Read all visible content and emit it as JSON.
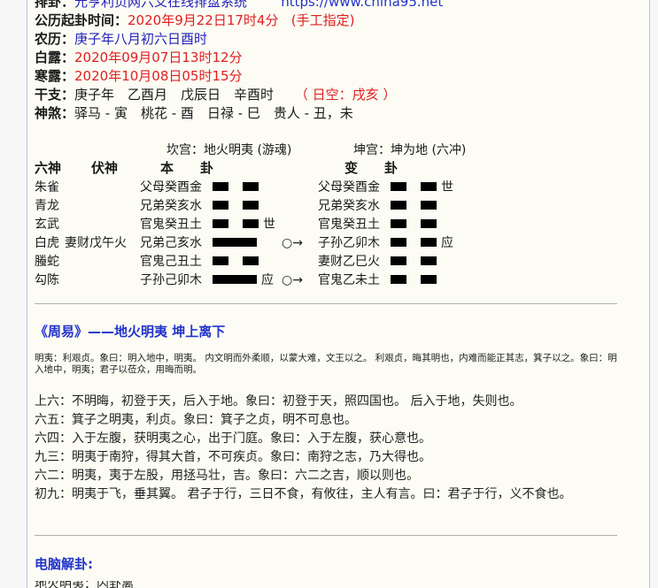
{
  "header": {
    "label_paigua": "排卦：",
    "site_desc": "元亨利贞网六爻在线排盘系统",
    "site_url": "https://www.china95.net",
    "label_time": "公历起卦时间：",
    "time_value": "2020年9月22日17时4分",
    "time_mode": "(手工指定)",
    "label_nongli": "农历：",
    "nongli_value": "庚子年八月初六日酉时",
    "label_bailu": "白露：",
    "bailu_value": "2020年09月07日13时12分",
    "label_hanlu": "寒露：",
    "hanlu_value": "2020年10月08日05时15分",
    "label_ganzhi": "干支：",
    "ganzhi_value": "庚子年　乙酉月　戊辰日　辛酉时",
    "kongwang": "（ 日空：戌亥 ）",
    "label_shensha": "神煞：",
    "shensha_value": "驿马 - 寅　桃花 - 酉　日禄 - 巳　贵人 - 丑，未"
  },
  "hexagram": {
    "main_title": "坎宫：地火明夷 (游魂)",
    "changed_title": "坤宫：坤为地 (六冲)",
    "headers": {
      "liushen": "六神",
      "fushen": "伏神",
      "ben": "本　　卦",
      "bian": "变　　卦"
    },
    "rows": [
      {
        "liushen": "朱雀",
        "fushen": "",
        "ben": "父母癸酉金",
        "ben_line": "yin",
        "ben_mark": "",
        "moving": "",
        "bian": "父母癸酉金",
        "bian_line": "yin",
        "bian_mark": "世"
      },
      {
        "liushen": "青龙",
        "fushen": "",
        "ben": "兄弟癸亥水",
        "ben_line": "yin",
        "ben_mark": "",
        "moving": "",
        "bian": "兄弟癸亥水",
        "bian_line": "yin",
        "bian_mark": ""
      },
      {
        "liushen": "玄武",
        "fushen": "",
        "ben": "官鬼癸丑土",
        "ben_line": "yin",
        "ben_mark": "世",
        "moving": "",
        "bian": "官鬼癸丑土",
        "bian_line": "yin",
        "bian_mark": ""
      },
      {
        "liushen": "白虎",
        "fushen": "妻财戊午火",
        "ben": "兄弟己亥水",
        "ben_line": "yang",
        "ben_mark": "",
        "moving": "○→",
        "bian": "子孙乙卯木",
        "bian_line": "yin",
        "bian_mark": "应"
      },
      {
        "liushen": "螣蛇",
        "fushen": "",
        "ben": "官鬼己丑土",
        "ben_line": "yin",
        "ben_mark": "",
        "moving": "",
        "bian": "妻财乙巳火",
        "bian_line": "yin",
        "bian_mark": ""
      },
      {
        "liushen": "勾陈",
        "fushen": "",
        "ben": "子孙己卯木",
        "ben_line": "yang",
        "ben_mark": "应",
        "moving": "○→",
        "bian": "官鬼乙未土",
        "bian_line": "yin",
        "bian_mark": ""
      }
    ]
  },
  "zhouyi": {
    "title": "《周易》——地火明夷 坤上离下",
    "note": "明夷：利艰贞。象曰：明入地中，明夷。 内文明而外柔顺，以蒙大难，文王以之。 利艰贞，晦其明也，内难而能正其志，箕子以之。象曰：明入地中，明夷；君子以莅众，用晦而明。",
    "yao": [
      "上六：不明晦，初登于天，后入于地。象曰：初登于天，照四国也。 后入于地，失则也。",
      "六五：箕子之明夷，利贞。象曰：箕子之贞，明不可息也。",
      "六四：入于左腹，获明夷之心，出于门庭。象曰：入于左腹，获心意也。",
      "九三：明夷于南狩，得其大首，不可疾贞。象曰：南狩之志，乃大得也。",
      "六二：明夷，夷于左股，用拯马壮，吉。象曰：六二之吉，顺以则也。",
      "初九：明夷于飞，垂其翼。 君子于行，三日不食，有攸往，主人有言。曰：君子于行，义不食也。"
    ]
  },
  "ai_section": {
    "title": "电脑解卦:",
    "partial_text": "地火明夷：内卦离"
  }
}
